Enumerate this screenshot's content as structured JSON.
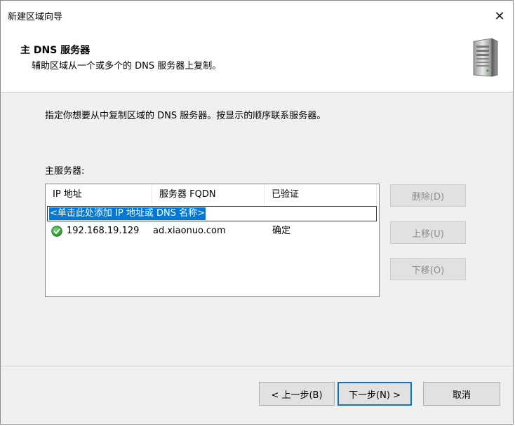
{
  "window": {
    "title": "新建区域向导",
    "close_glyph": "✕"
  },
  "header": {
    "title": "主 DNS 服务器",
    "subtitle": "辅助区域从一个或多个的 DNS 服务器上复制。",
    "icon": "server-icon"
  },
  "body": {
    "instruction": "指定你想要从中复制区域的 DNS 服务器。按显示的顺序联系服务器。",
    "list_label": "主服务器:",
    "columns": [
      "IP 地址",
      "服务器 FQDN",
      "已验证"
    ],
    "edit_row": "<单击此处添加 IP 地址或 DNS 名称>",
    "rows": [
      {
        "ip": "192.168.19.129",
        "fqdn": "ad.xiaonuo.com",
        "verified": "确定",
        "status_icon": "green-check-icon"
      }
    ],
    "side_buttons": {
      "delete": "删除(D)",
      "up": "上移(U)",
      "down": "下移(O)"
    }
  },
  "footer": {
    "back": "< 上一步(B)",
    "next": "下一步(N) >",
    "cancel": "取消"
  },
  "colors": {
    "accent": "#0078d7",
    "check": "#2e9e2e"
  }
}
